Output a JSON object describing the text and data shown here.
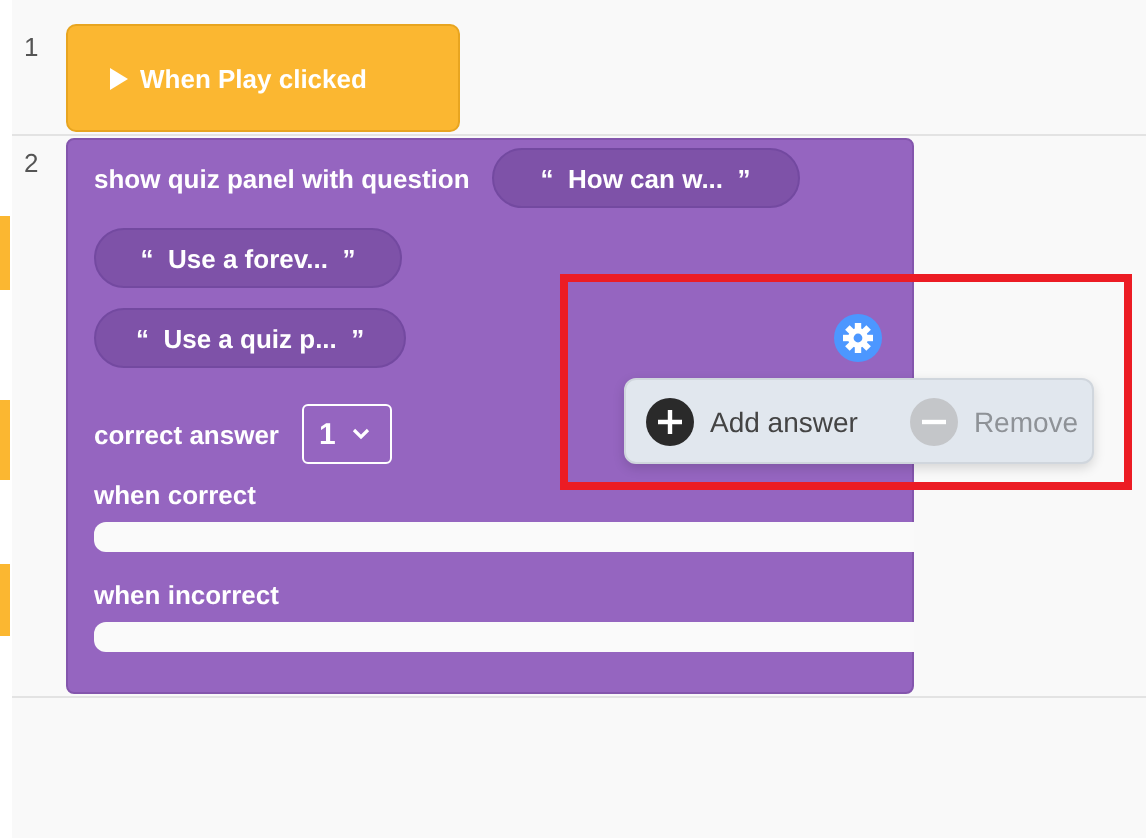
{
  "line_numbers": [
    "1",
    "2"
  ],
  "event_block": {
    "label": "When Play clicked"
  },
  "quiz_block": {
    "title": "show quiz panel with question",
    "question": "How can w...",
    "answers": [
      "Use a forev...",
      "Use a quiz p..."
    ],
    "quote_open": "“",
    "quote_close": "”",
    "correct_label": "correct answer",
    "correct_value": "1",
    "when_correct": "when correct",
    "when_incorrect": "when incorrect"
  },
  "popup": {
    "add_label": "Add answer",
    "remove_label": "Remove",
    "remove_disabled": true
  }
}
